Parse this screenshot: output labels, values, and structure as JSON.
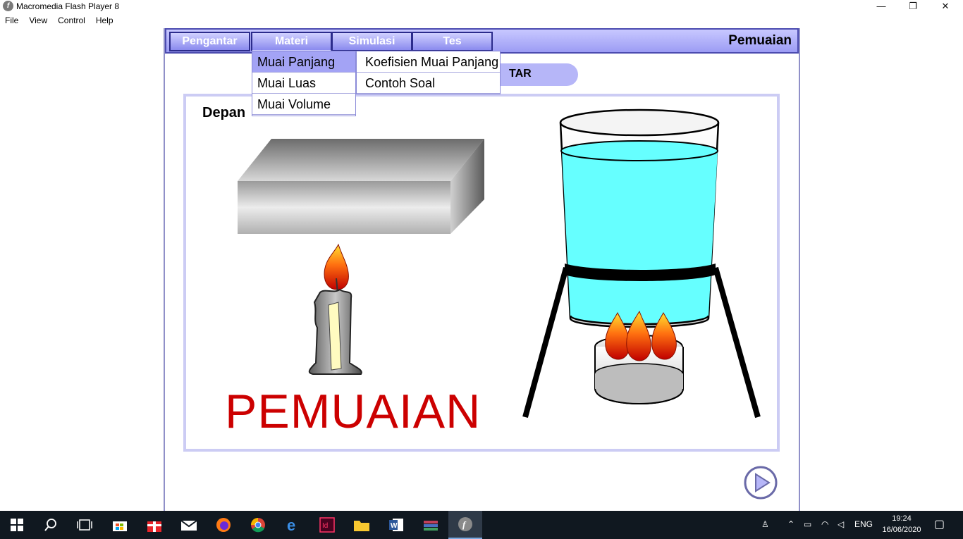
{
  "window": {
    "title": "Macromedia Flash Player 8",
    "controls": {
      "minimize": "—",
      "maximize": "❐",
      "close": "✕"
    }
  },
  "menubar": [
    "File",
    "View",
    "Control",
    "Help"
  ],
  "flash": {
    "nav_tabs": [
      "Pengantar",
      "Materi",
      "Simulasi",
      "Tes"
    ],
    "page_title": "Pemuaian",
    "pill_label": "TAR",
    "content_heading": "Depan",
    "big_title": "PEMUAIAN",
    "dropdown_primary": [
      "Muai Panjang",
      "Muai Luas",
      "Muai Volume"
    ],
    "dropdown_secondary": [
      "Koefisien Muai Panjang",
      "Contoh Soal"
    ],
    "colors": {
      "nav_bg": "#9c9cf4",
      "accent_red": "#cc0000",
      "water": "#66ffff",
      "menu_highlight": "#a3a3f5"
    }
  },
  "taskbar": {
    "apps": [
      "start-icon",
      "search-icon",
      "task-view-icon",
      "store-icon",
      "gift-icon",
      "mail-icon",
      "firefox-icon",
      "chrome-icon",
      "edge-icon",
      "indesign-icon",
      "file-explorer-icon",
      "word-icon",
      "winrar-icon",
      "flash-player-icon"
    ],
    "language": "ENG",
    "time": "19:24",
    "date": "16/06/2020"
  }
}
